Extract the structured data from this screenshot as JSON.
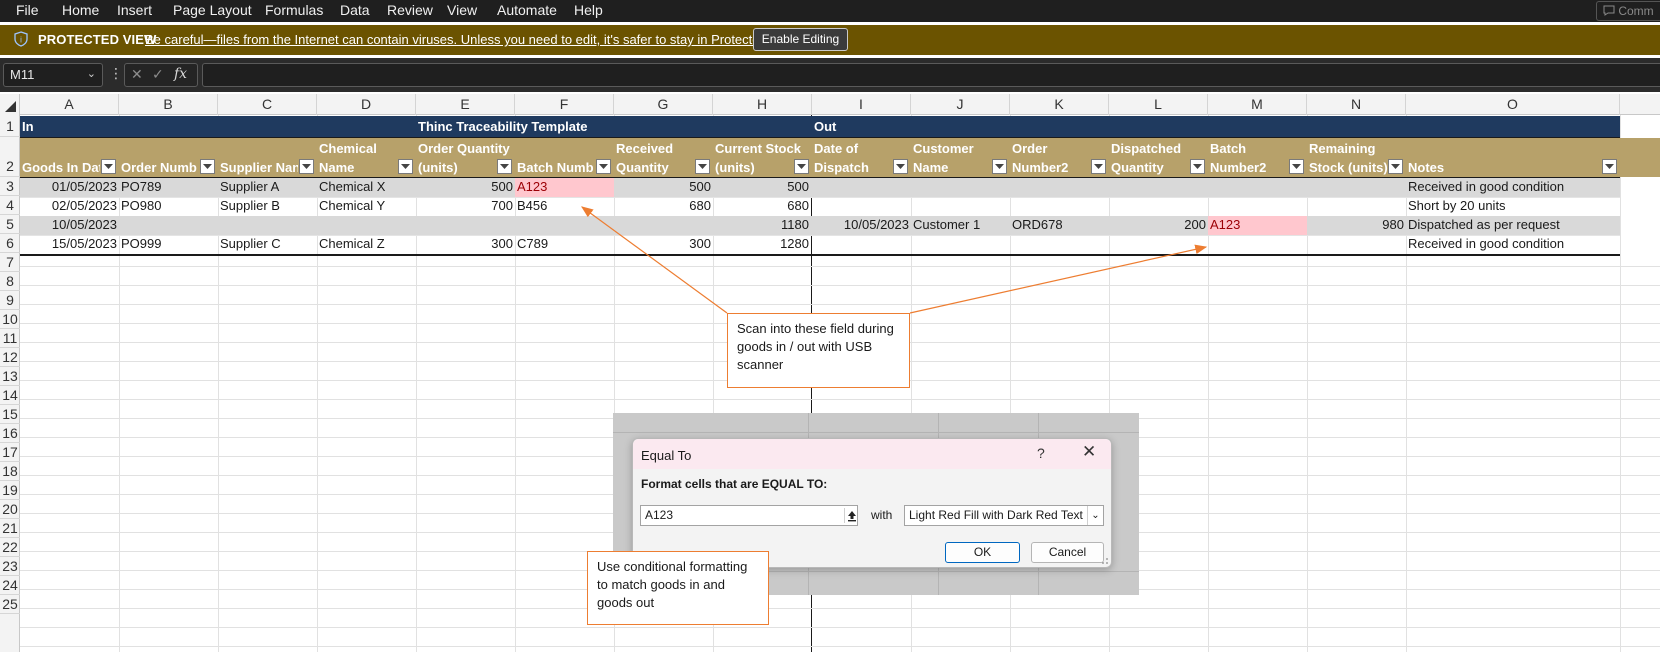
{
  "menu": {
    "items": [
      "File",
      "Home",
      "Insert",
      "Page Layout",
      "Formulas",
      "Data",
      "Review",
      "View",
      "Automate",
      "Help"
    ],
    "comments_label": "Comm",
    "comments_icon": "comment-icon"
  },
  "protected_view": {
    "title": "PROTECTED VIEW",
    "message": "Be careful—files from the Internet can contain viruses. Unless you need to edit, it's safer to stay in Protected View.",
    "enable_button": "Enable Editing",
    "icon": "shield-icon"
  },
  "formula_bar": {
    "name_box": "M11",
    "fx": "fx",
    "value": ""
  },
  "columns": [
    "A",
    "B",
    "C",
    "D",
    "E",
    "F",
    "G",
    "H",
    "I",
    "J",
    "K",
    "L",
    "M",
    "N",
    "O"
  ],
  "rows": [
    "1",
    "2",
    "3",
    "4",
    "5",
    "6",
    "7",
    "8",
    "9",
    "10",
    "11",
    "12",
    "13",
    "14",
    "15",
    "16",
    "17",
    "18",
    "19",
    "20",
    "21",
    "22",
    "23",
    "24",
    "25"
  ],
  "sheet": {
    "banner": {
      "in": "In",
      "title": "Thinc Traceability Template",
      "out": "Out"
    },
    "headers": [
      {
        "l1": "",
        "l2": "Goods In Dat"
      },
      {
        "l1": "",
        "l2": "Order Numb"
      },
      {
        "l1": "",
        "l2": "Supplier Nan"
      },
      {
        "l1": "Chemical",
        "l2": "Name"
      },
      {
        "l1": "Order Quantity",
        "l2": "(units)"
      },
      {
        "l1": "",
        "l2": "Batch Numb"
      },
      {
        "l1": "Received",
        "l2": "Quantity"
      },
      {
        "l1": "Current Stock",
        "l2": "(units)"
      },
      {
        "l1": "Date of",
        "l2": "Dispatch"
      },
      {
        "l1": "Customer",
        "l2": "Name"
      },
      {
        "l1": "Order",
        "l2": "Number2"
      },
      {
        "l1": "Dispatched",
        "l2": "Quantity"
      },
      {
        "l1": "Batch",
        "l2": "Number2"
      },
      {
        "l1": "Remaining",
        "l2": "Stock (units)"
      },
      {
        "l1": "",
        "l2": "Notes"
      }
    ],
    "data_rows": [
      [
        "01/05/2023",
        "PO789",
        "Supplier A",
        "Chemical X",
        "500",
        "A123",
        "500",
        "500",
        "",
        "",
        "",
        "",
        "",
        "",
        "Received in good condition"
      ],
      [
        "02/05/2023",
        "PO980",
        "Supplier B",
        "Chemical Y",
        "700",
        "B456",
        "680",
        "680",
        "",
        "",
        "",
        "",
        "",
        "",
        "Short by 20 units"
      ],
      [
        "10/05/2023",
        "",
        "",
        "",
        "",
        "",
        "",
        "1180",
        "10/05/2023",
        "Customer 1",
        "ORD678",
        "200",
        "A123",
        "980",
        "Dispatched as per request"
      ],
      [
        "15/05/2023",
        "PO999",
        "Supplier C",
        "Chemical Z",
        "300",
        "C789",
        "300",
        "1280",
        "",
        "",
        "",
        "",
        "",
        "",
        "Received in good condition"
      ]
    ]
  },
  "callouts": {
    "scan": "Scan into these field during goods in / out with USB scanner",
    "cf": "Use conditional formatting to match goods in and goods out"
  },
  "dialog": {
    "title": "Equal To",
    "help": "?",
    "close": "✕",
    "label": "Format cells that are EQUAL TO:",
    "value": "A123",
    "with_label": "with",
    "format_option": "Light Red Fill with Dark Red Text",
    "ok": "OK",
    "cancel": "Cancel"
  },
  "colors": {
    "banner": "#1f3a5f",
    "header": "#b7a16a",
    "band": "#d9d9d9",
    "highlight_fill": "#ffc7ce",
    "highlight_text": "#9c0006",
    "callout_border": "#ed7d31"
  }
}
